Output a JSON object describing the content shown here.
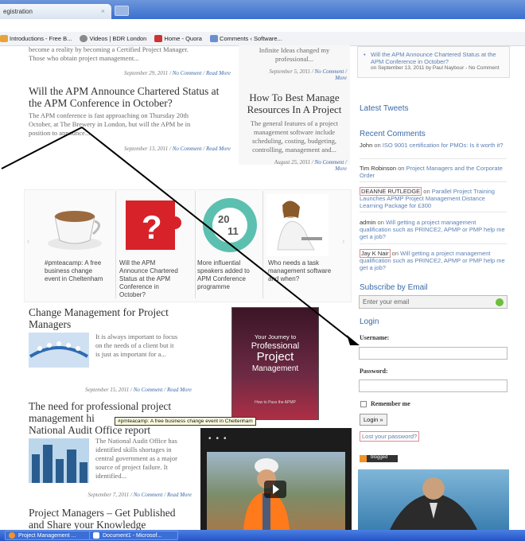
{
  "tab": {
    "title": "egistration",
    "close": "×"
  },
  "bookmarks": [
    "Introductions - Free B...",
    "Videos | BDR London",
    "Home - Quora",
    "Comments ‹ Software..."
  ],
  "posts": {
    "top_text": [
      "become a reality by becoming a Certified Project Manager.",
      "Those who obtain project management..."
    ],
    "top_meta": {
      "date": "September 29, 2011 /",
      "comment": "No Comment",
      "sep": "/",
      "read": "Read More"
    },
    "apm": {
      "title_1": "Will the APM Announce Chartered Status at",
      "title_2": "the APM Conference in October?",
      "body_1": "The APM conference is fast approaching on Thursday 20th",
      "body_2": "October, at The Brewery in London, but will the APM be in",
      "body_3": "position to announce...",
      "date": "September 13, 2011 /",
      "comment": "No Comment",
      "sep": "/",
      "read": "Read More"
    },
    "mid_top_1": "Infinite Ideas changed my",
    "mid_top_2": "professional...",
    "mid_meta": {
      "date": "September 5, 2011 /",
      "comment": "No Comment /",
      "more": "More"
    },
    "manage": {
      "title_1": "How To Best Manage",
      "title_2": "Resources In A Project",
      "body_1": "The general features of a project",
      "body_2": "management software include",
      "body_3": "scheduling, costing, budgeting,",
      "body_4": "controlling, management and...",
      "date": "August 25, 2011 /",
      "comment": "No Comment /",
      "more": "More"
    }
  },
  "carousel": [
    {
      "cap": "#pmteacamp: A free business change event in Cheltenham"
    },
    {
      "cap": "Will the APM Announce Chartered Status at the APM Conference in October?"
    },
    {
      "cap": "More influential speakers added to APM Conference programme",
      "badge_1": "20",
      "badge_2": "11"
    },
    {
      "cap": "Who needs a task management software and when?"
    }
  ],
  "change": {
    "title_1": "Change Management for Project",
    "title_2": "Managers",
    "body_1": "It is always important to focus",
    "body_2": "on the needs of a client but it",
    "body_3": "is just as important for a...",
    "date": "September 15, 2011 /",
    "comment": "No Comment",
    "sep": "/",
    "read": "Read More"
  },
  "need": {
    "title_1": "The need for professional project",
    "title_2": "management hi",
    "title_3": "National Audit Office report",
    "tooltip": "#pmteacamp: A free business change event in Cheltenham",
    "body_1": "The National Audit Office has",
    "body_2": "identified skills shortages in",
    "body_3": "central government as a major",
    "body_4": "source of project failure. It",
    "body_5": "identified...",
    "date": "September 7, 2011 /",
    "comment": "No Comment",
    "sep": "/",
    "read": "Read More"
  },
  "publish": {
    "title_1": "Project Managers – Get Published",
    "title_2": "and Share your Knowledge"
  },
  "book": {
    "line1": "Your Journey to",
    "line2": "Professional",
    "line3": "Project",
    "line4": "Management",
    "sub": "How to Pass the APMP"
  },
  "sidebar": {
    "top_item": "Will the APM Announce Chartered Status at the APM Conference in October?",
    "top_meta": "on September 13, 2011 by Paul Naybour - No Comment",
    "latest_tweets": "Latest Tweets",
    "recent_comments": "Recent Comments",
    "comments": [
      {
        "author": "John",
        "on": " on ",
        "post": "ISO 9001 certification for PMOs: Is it worth it?"
      },
      {
        "author": "Tim Robinson",
        "on": " on ",
        "post": "Project Managers and the Corporate Order"
      },
      {
        "author": "DEANNE RUTLEDGE",
        "on": " on ",
        "post": "Parallel Project Training Launches APMP Project Management Distance Learning Package for £300"
      },
      {
        "author": "admin",
        "on": " on ",
        "post": "Will getting a project management qualification such as PRINCE2, APMP or PMP help me get a job?"
      },
      {
        "author": "Jay K Nair",
        "on": " on ",
        "post": "Will getting a project management qualification such as PRINCE2, APMP or PMP help me get a job?"
      }
    ],
    "subscribe": "Subscribe by Email",
    "email_placeholder": "Enter your email",
    "login": "Login",
    "username": "Username:",
    "password": "Password:",
    "remember": "Remember me",
    "login_btn": "Login »",
    "lost": "Lost your password?",
    "blogged": "blogged"
  },
  "taskbar": {
    "item1": "Project Management ...",
    "item2": "Document1 - Microsof..."
  },
  "colors": {
    "link": "#3c68a9",
    "sidebar_heading": "#3a6aa6",
    "taskbar": "#2454c6"
  }
}
